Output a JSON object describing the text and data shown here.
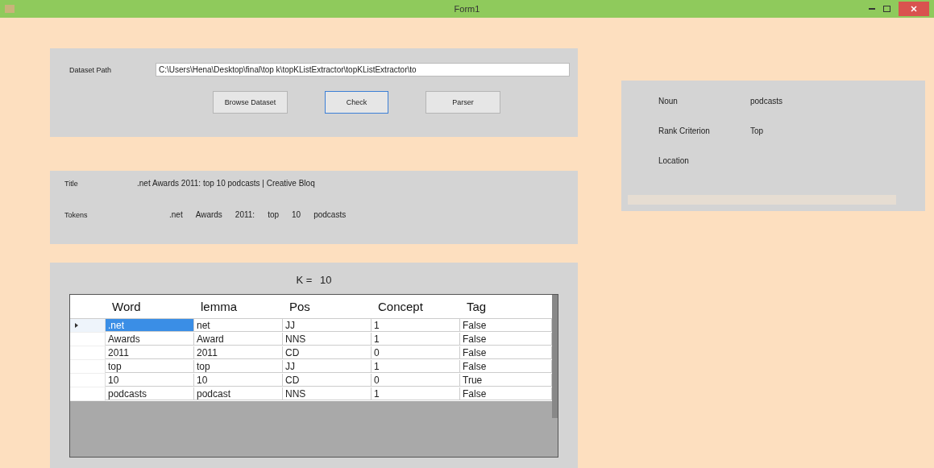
{
  "window": {
    "title": "Form1"
  },
  "dataset": {
    "label": "Dataset Path",
    "value": "C:\\Users\\Hena\\Desktop\\final\\top k\\topKListExtractor\\topKListExtractor\\to",
    "buttons": [
      {
        "label": "Browse Dataset",
        "focused": false
      },
      {
        "label": "Check",
        "focused": true
      },
      {
        "label": "Parser",
        "focused": false
      }
    ]
  },
  "title_panel": {
    "title_label": "Title",
    "title_value": ".net Awards 2011: top 10 podcasts | Creative Bloq",
    "tokens_label": "Tokens",
    "tokens": [
      ".net",
      "Awards",
      "2011:",
      "top",
      "10",
      "podcasts"
    ]
  },
  "info_panel": {
    "fields": [
      {
        "label": "Noun",
        "value": "podcasts"
      },
      {
        "label": "Rank Criterion",
        "value": "Top"
      },
      {
        "label": "Location"
      }
    ]
  },
  "k_panel": {
    "k_label": "K = ",
    "k_value": "10"
  },
  "table": {
    "columns": [
      "Word",
      "lemma",
      "Pos",
      "Concept",
      "Tag"
    ],
    "rows": [
      {
        "cells": [
          ".net",
          "net",
          "JJ",
          "1",
          "False"
        ],
        "selected": true
      },
      {
        "cells": [
          "Awards",
          "Award",
          "NNS",
          "1",
          "False"
        ],
        "selected": false
      },
      {
        "cells": [
          "2011",
          "2011",
          "CD",
          "0",
          "False"
        ],
        "selected": false
      },
      {
        "cells": [
          "top",
          "top",
          "JJ",
          "1",
          "False"
        ],
        "selected": false
      },
      {
        "cells": [
          "10",
          "10",
          "CD",
          "0",
          "True"
        ],
        "selected": false
      },
      {
        "cells": [
          "podcasts",
          "podcast",
          "NNS",
          "1",
          "False"
        ],
        "selected": false
      }
    ]
  }
}
